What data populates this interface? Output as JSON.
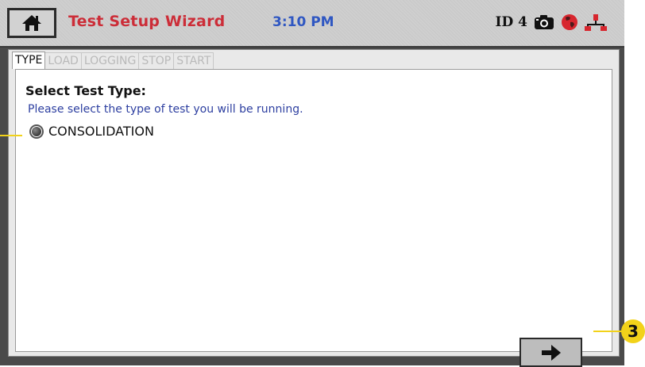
{
  "header": {
    "title": "Test Setup Wizard",
    "time": "3:10 PM",
    "device_id": "ID 4",
    "title_color": "#cc2d38",
    "time_color": "#2f57c2",
    "icons": [
      "home-icon",
      "camera-icon",
      "globe-icon",
      "network-icon"
    ]
  },
  "tabs": [
    {
      "label": "TYPE",
      "active": true
    },
    {
      "label": "LOAD",
      "active": false
    },
    {
      "label": "LOGGING",
      "active": false
    },
    {
      "label": "STOP",
      "active": false
    },
    {
      "label": "START",
      "active": false
    }
  ],
  "main": {
    "heading": "Select Test Type:",
    "subtitle": "Please select the type of test you will be running.",
    "options": [
      {
        "label": "CONSOLIDATION",
        "selected": true
      }
    ]
  },
  "navigation": {
    "next_icon": "arrow-right-icon"
  },
  "callouts": {
    "badge": "3",
    "color": "#f2d21a"
  }
}
